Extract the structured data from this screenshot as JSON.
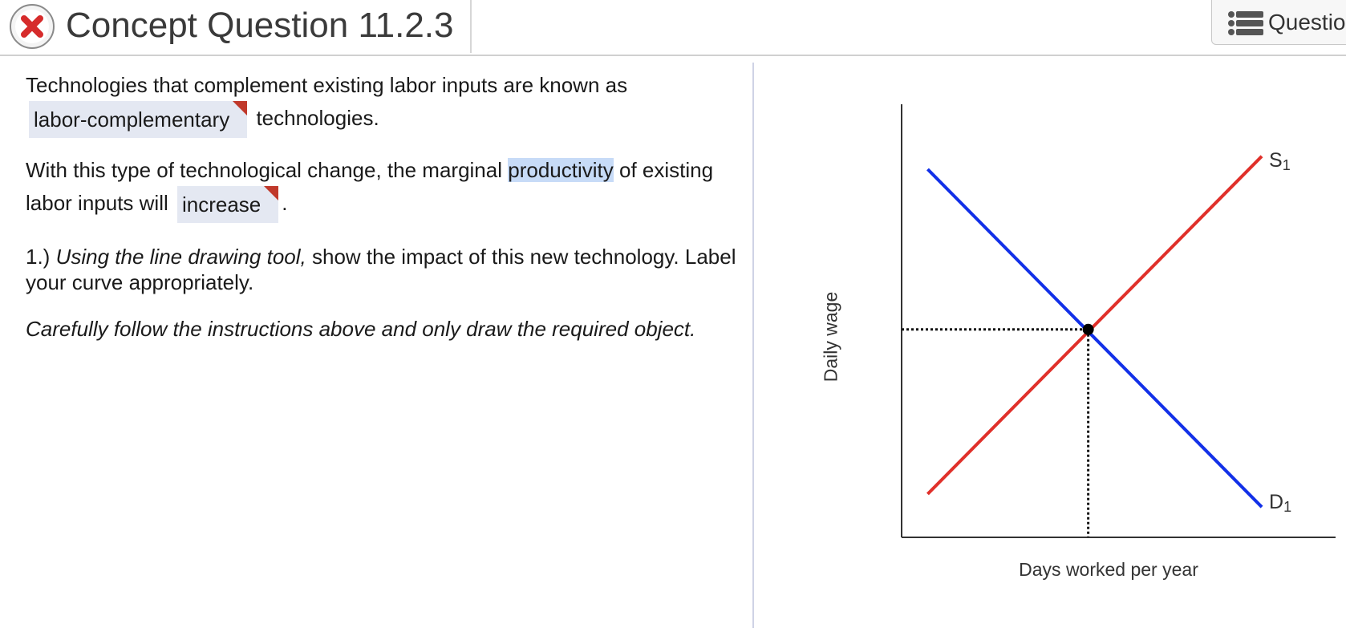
{
  "header": {
    "title": "Concept Question 11.2.3",
    "questions_button_label": "Questio"
  },
  "content": {
    "p1_before": "Technologies that complement existing labor inputs are known as",
    "p1_dropdown_value": "labor-complementary",
    "p1_after": "technologies.",
    "p2_before": "With this type of technological change, the marginal",
    "p2_highlight": "productivity",
    "p2_mid": "of existing labor inputs will",
    "p2_dropdown_value": "increase",
    "p2_after": ".",
    "q1_prefix": "1.)",
    "q1_italic": "Using the line drawing tool,",
    "q1_rest": "show the impact of this new technology. Label your curve appropriately.",
    "instruction": "Carefully follow the instructions above and only draw the required object."
  },
  "chart_data": {
    "type": "line",
    "title": "",
    "xlabel": "Days worked per year",
    "ylabel": "Daily wage",
    "x_ticks": [],
    "y_ticks": [],
    "series": [
      {
        "name": "S",
        "subscript": "1",
        "color": "#e0302a",
        "points": [
          [
            0.06,
            0.1
          ],
          [
            0.83,
            0.88
          ]
        ]
      },
      {
        "name": "D",
        "subscript": "1",
        "color": "#1230e8",
        "points": [
          [
            0.06,
            0.85
          ],
          [
            0.83,
            0.07
          ]
        ]
      }
    ],
    "equilibrium": {
      "x": 0.43,
      "y": 0.48
    },
    "xlim": [
      0,
      1
    ],
    "ylim": [
      0,
      1
    ]
  }
}
